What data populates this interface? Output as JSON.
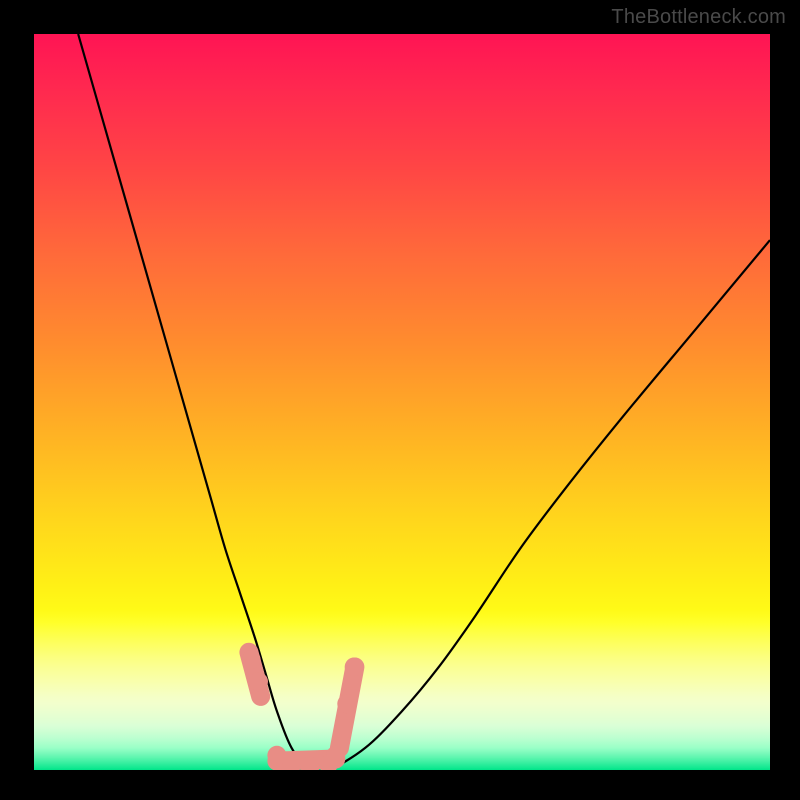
{
  "watermark": "TheBottleneck.com",
  "chart_data": {
    "type": "line",
    "title": "",
    "xlabel": "",
    "ylabel": "",
    "xlim": [
      0,
      100
    ],
    "ylim": [
      0,
      100
    ],
    "background_gradient": {
      "top_color": "#ff1454",
      "mid_color": "#ffe018",
      "bottom_color": "#00e58a"
    },
    "series": [
      {
        "name": "bottleneck-curve",
        "color": "#000000",
        "x": [
          6,
          10,
          14,
          18,
          22,
          24,
          26,
          28,
          30,
          31.5,
          33,
          35,
          37.5,
          40,
          45,
          50,
          55,
          60,
          66,
          72,
          80,
          90,
          100
        ],
        "y": [
          100,
          86,
          72,
          58,
          44,
          37,
          30,
          24,
          18,
          13,
          8,
          3,
          0,
          0,
          3,
          8,
          14,
          21,
          30,
          38,
          48,
          60,
          72
        ]
      }
    ],
    "markers": {
      "name": "highlight-dots",
      "color": "#e88d85",
      "x": [
        29.5,
        30.5,
        33,
        35,
        37.5,
        40,
        41,
        42.5,
        43.5
      ],
      "y": [
        15,
        12,
        2,
        0.8,
        0.5,
        0.8,
        2,
        9,
        14
      ]
    }
  }
}
